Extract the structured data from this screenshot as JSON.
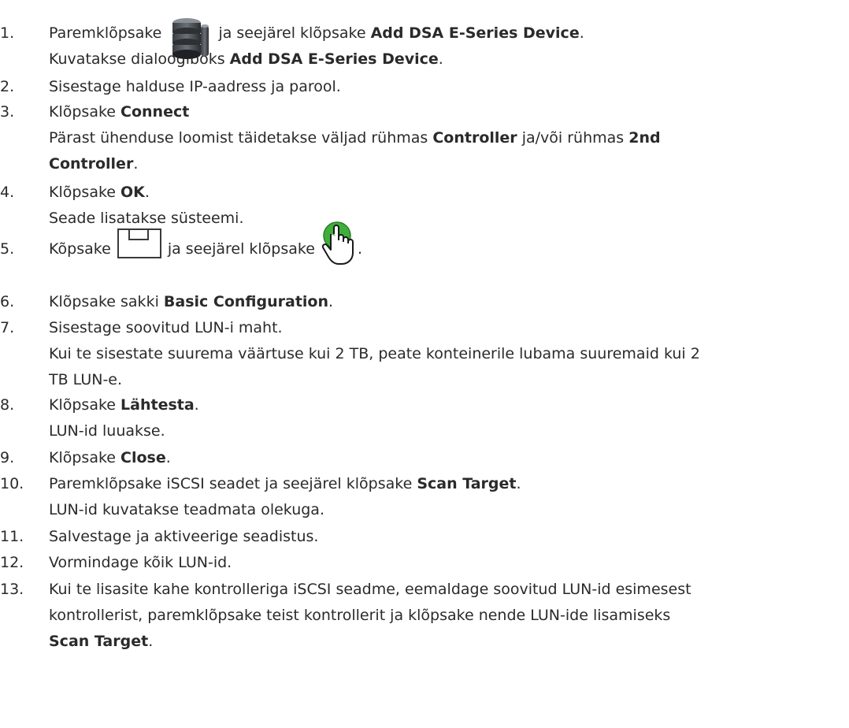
{
  "steps": [
    {
      "num": "1.",
      "lines": [
        [
          "Paremklõpsake ",
          {
            "icon": "storage-icon"
          },
          " ja seejärel klõpsake ",
          {
            "b": "Add DSA E-Series Device"
          },
          "."
        ],
        [
          "Kuvatakse dialoogiboks ",
          {
            "b": "Add DSA E-Series Device"
          },
          "."
        ]
      ]
    },
    {
      "num": "2.",
      "lines": [
        [
          "Sisestage halduse IP-aadress ja parool."
        ]
      ]
    },
    {
      "num": "3.",
      "lines": [
        [
          "Klõpsake ",
          {
            "b": "Connect"
          }
        ],
        [
          "Pärast ühenduse loomist täidetakse väljad rühmas ",
          {
            "b": "Controller"
          },
          " ja/või rühmas ",
          {
            "b": "2nd"
          }
        ],
        [
          {
            "b": "Controller"
          },
          "."
        ]
      ]
    },
    {
      "num": "4.",
      "lines": [
        [
          "Klõpsake ",
          {
            "b": "OK"
          },
          "."
        ],
        [
          "Seade lisatakse süsteemi."
        ]
      ]
    },
    {
      "num": "5.",
      "lines": [
        [
          "Kõpsake ",
          {
            "icon": "save-icon"
          },
          " ja seejärel klõpsake ",
          {
            "icon": "activate-icon"
          },
          "."
        ]
      ]
    },
    {
      "num": "6.",
      "lines": [
        [
          "Klõpsake sakki ",
          {
            "b": "Basic Configuration"
          },
          "."
        ]
      ]
    },
    {
      "num": "7.",
      "lines": [
        [
          "Sisestage soovitud LUN-i maht."
        ],
        [
          "Kui te sisestate suurema väärtuse kui 2 TB, peate konteinerile lubama suuremaid kui 2"
        ],
        [
          "TB LUN-e."
        ]
      ]
    },
    {
      "num": "8.",
      "lines": [
        [
          "Klõpsake ",
          {
            "b": "Lähtesta"
          },
          "."
        ],
        [
          "LUN-id luuakse."
        ]
      ]
    },
    {
      "num": "9.",
      "lines": [
        [
          "Klõpsake ",
          {
            "b": "Close"
          },
          "."
        ]
      ]
    },
    {
      "num": "10.",
      "lines": [
        [
          "Paremklõpsake iSCSI seadet ja seejärel klõpsake ",
          {
            "b": "Scan Target"
          },
          "."
        ],
        [
          "LUN-id kuvatakse teadmata olekuga."
        ]
      ]
    },
    {
      "num": "11.",
      "lines": [
        [
          "Salvestage ja aktiveerige seadistus."
        ]
      ]
    },
    {
      "num": "12.",
      "lines": [
        [
          "Vormindage kõik LUN-id."
        ]
      ]
    },
    {
      "num": "13.",
      "lines": [
        [
          "Kui te lisasite kahe kontrolleriga iSCSI seadme, eemaldage soovitud LUN-id esimesest"
        ],
        [
          "kontrollerist, paremklõpsake teist kontrollerit ja klõpsake nende LUN-ide lisamiseks"
        ],
        [
          {
            "b": "Scan Target"
          },
          "."
        ]
      ]
    }
  ]
}
